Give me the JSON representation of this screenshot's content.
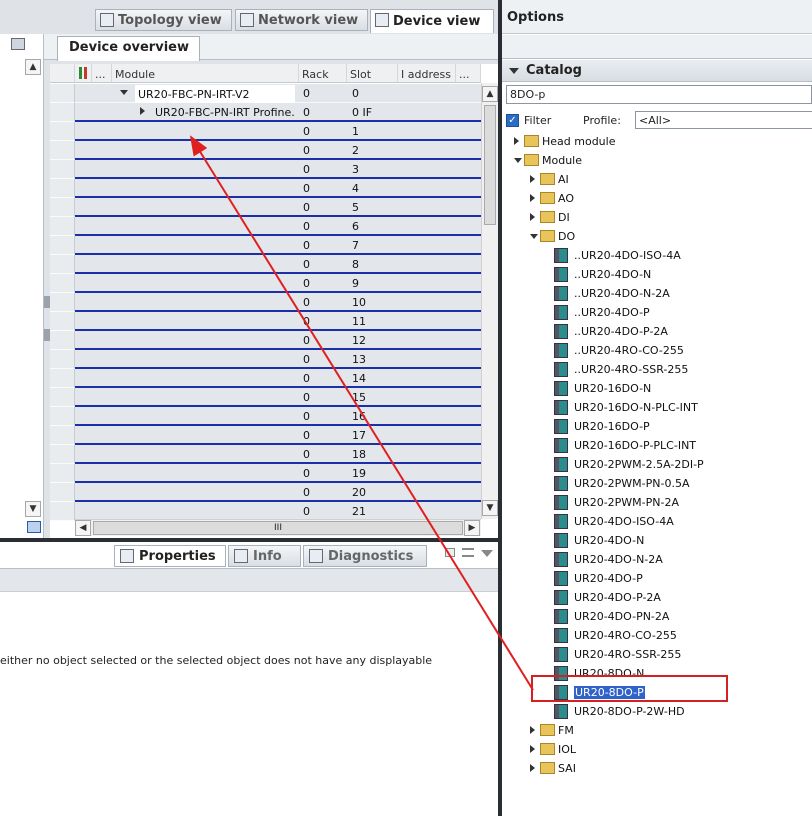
{
  "view_tabs": {
    "topology": "Topology view",
    "network": "Network view",
    "device": "Device view"
  },
  "device_overview": {
    "tab_label": "Device overview",
    "columns": {
      "module": "Module",
      "rack": "Rack",
      "slot": "Slot",
      "iaddress": "I address",
      "more": "...",
      "flag": "..."
    },
    "rows": [
      {
        "module": "UR20-FBC-PN-IRT-V2",
        "rack": "0",
        "slot": "0"
      },
      {
        "module": "UR20-FBC-PN-IRT Profine...",
        "rack": "0",
        "slot": "0 IF"
      },
      {
        "module": "",
        "rack": "0",
        "slot": "1"
      },
      {
        "module": "",
        "rack": "0",
        "slot": "2"
      },
      {
        "module": "",
        "rack": "0",
        "slot": "3"
      },
      {
        "module": "",
        "rack": "0",
        "slot": "4"
      },
      {
        "module": "",
        "rack": "0",
        "slot": "5"
      },
      {
        "module": "",
        "rack": "0",
        "slot": "6"
      },
      {
        "module": "",
        "rack": "0",
        "slot": "7"
      },
      {
        "module": "",
        "rack": "0",
        "slot": "8"
      },
      {
        "module": "",
        "rack": "0",
        "slot": "9"
      },
      {
        "module": "",
        "rack": "0",
        "slot": "10"
      },
      {
        "module": "",
        "rack": "0",
        "slot": "11"
      },
      {
        "module": "",
        "rack": "0",
        "slot": "12"
      },
      {
        "module": "",
        "rack": "0",
        "slot": "13"
      },
      {
        "module": "",
        "rack": "0",
        "slot": "14"
      },
      {
        "module": "",
        "rack": "0",
        "slot": "15"
      },
      {
        "module": "",
        "rack": "0",
        "slot": "16"
      },
      {
        "module": "",
        "rack": "0",
        "slot": "17"
      },
      {
        "module": "",
        "rack": "0",
        "slot": "18"
      },
      {
        "module": "",
        "rack": "0",
        "slot": "19"
      },
      {
        "module": "",
        "rack": "0",
        "slot": "20"
      },
      {
        "module": "",
        "rack": "0",
        "slot": "21"
      }
    ],
    "hscroll_grip": "III"
  },
  "properties_tabs": {
    "properties": "Properties",
    "info": "Info",
    "diagnostics": "Diagnostics"
  },
  "properties_message": "either no object selected or the selected object does not have any displayable",
  "options": {
    "title": "Options"
  },
  "catalog": {
    "title": "Catalog",
    "search_value": "8DO-p",
    "filter_label": "Filter",
    "profile_label": "Profile:",
    "profile_value": "<All>",
    "tree": [
      {
        "label": "Head module",
        "kind": "folder",
        "state": "collapsed",
        "level": 0
      },
      {
        "label": "Module",
        "kind": "folder",
        "state": "expanded",
        "level": 0
      },
      {
        "label": "AI",
        "kind": "folder",
        "state": "collapsed",
        "level": 1
      },
      {
        "label": "AO",
        "kind": "folder",
        "state": "collapsed",
        "level": 1
      },
      {
        "label": "DI",
        "kind": "folder",
        "state": "collapsed",
        "level": 1
      },
      {
        "label": "DO",
        "kind": "folder",
        "state": "expanded",
        "level": 1
      },
      {
        "label": "..UR20-4DO-ISO-4A",
        "kind": "module",
        "level": 2
      },
      {
        "label": "..UR20-4DO-N",
        "kind": "module",
        "level": 2
      },
      {
        "label": "..UR20-4DO-N-2A",
        "kind": "module",
        "level": 2
      },
      {
        "label": "..UR20-4DO-P",
        "kind": "module",
        "level": 2
      },
      {
        "label": "..UR20-4DO-P-2A",
        "kind": "module",
        "level": 2
      },
      {
        "label": "..UR20-4RO-CO-255",
        "kind": "module",
        "level": 2
      },
      {
        "label": "..UR20-4RO-SSR-255",
        "kind": "module",
        "level": 2
      },
      {
        "label": "UR20-16DO-N",
        "kind": "module",
        "level": 2
      },
      {
        "label": "UR20-16DO-N-PLC-INT",
        "kind": "module",
        "level": 2
      },
      {
        "label": "UR20-16DO-P",
        "kind": "module",
        "level": 2
      },
      {
        "label": "UR20-16DO-P-PLC-INT",
        "kind": "module",
        "level": 2
      },
      {
        "label": "UR20-2PWM-2.5A-2DI-P",
        "kind": "module",
        "level": 2
      },
      {
        "label": "UR20-2PWM-PN-0.5A",
        "kind": "module",
        "level": 2
      },
      {
        "label": "UR20-2PWM-PN-2A",
        "kind": "module",
        "level": 2
      },
      {
        "label": "UR20-4DO-ISO-4A",
        "kind": "module",
        "level": 2
      },
      {
        "label": "UR20-4DO-N",
        "kind": "module",
        "level": 2
      },
      {
        "label": "UR20-4DO-N-2A",
        "kind": "module",
        "level": 2
      },
      {
        "label": "UR20-4DO-P",
        "kind": "module",
        "level": 2
      },
      {
        "label": "UR20-4DO-P-2A",
        "kind": "module",
        "level": 2
      },
      {
        "label": "UR20-4DO-PN-2A",
        "kind": "module",
        "level": 2
      },
      {
        "label": "UR20-4RO-CO-255",
        "kind": "module",
        "level": 2
      },
      {
        "label": "UR20-4RO-SSR-255",
        "kind": "module",
        "level": 2
      },
      {
        "label": "UR20-8DO-N",
        "kind": "module",
        "level": 2
      },
      {
        "label": "UR20-8DO-P",
        "kind": "module",
        "level": 2,
        "selected": true
      },
      {
        "label": "UR20-8DO-P-2W-HD",
        "kind": "module",
        "level": 2
      },
      {
        "label": "FM",
        "kind": "folder",
        "state": "collapsed",
        "level": 1
      },
      {
        "label": "IOL",
        "kind": "folder",
        "state": "collapsed",
        "level": 1
      },
      {
        "label": "SAI",
        "kind": "folder",
        "state": "collapsed",
        "level": 1
      }
    ]
  },
  "colors": {
    "annotation": "#e02020",
    "selection": "#2f63c9",
    "slot_line": "#1b2fa8"
  }
}
